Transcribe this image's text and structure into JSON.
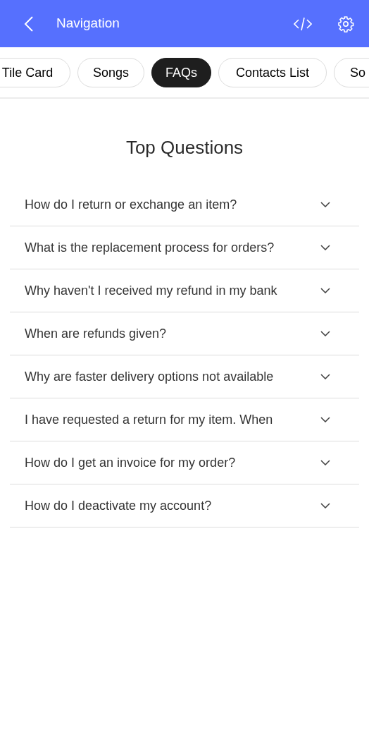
{
  "app_bar": {
    "title": "Navigation"
  },
  "tabs": [
    {
      "label": "Tile Card",
      "selected": false
    },
    {
      "label": "Songs",
      "selected": false
    },
    {
      "label": "FAQs",
      "selected": true
    },
    {
      "label": "Contacts List",
      "selected": false
    },
    {
      "label": "So",
      "selected": false
    }
  ],
  "faq": {
    "title": "Top Questions",
    "questions": [
      {
        "text": "How do I return or exchange an item?",
        "expanded": false
      },
      {
        "text": "What is the replacement process for orders?",
        "expanded": false
      },
      {
        "text": "Why haven't I received my refund in my bank",
        "expanded": false
      },
      {
        "text": "When are refunds given?",
        "expanded": false
      },
      {
        "text": "Why are faster delivery options not available",
        "expanded": false
      },
      {
        "text": "I have requested a return for my item. When",
        "expanded": false
      },
      {
        "text": "How do I get an invoice for my order?",
        "expanded": false
      },
      {
        "text": "How do I deactivate my account?",
        "expanded": false
      }
    ]
  }
}
